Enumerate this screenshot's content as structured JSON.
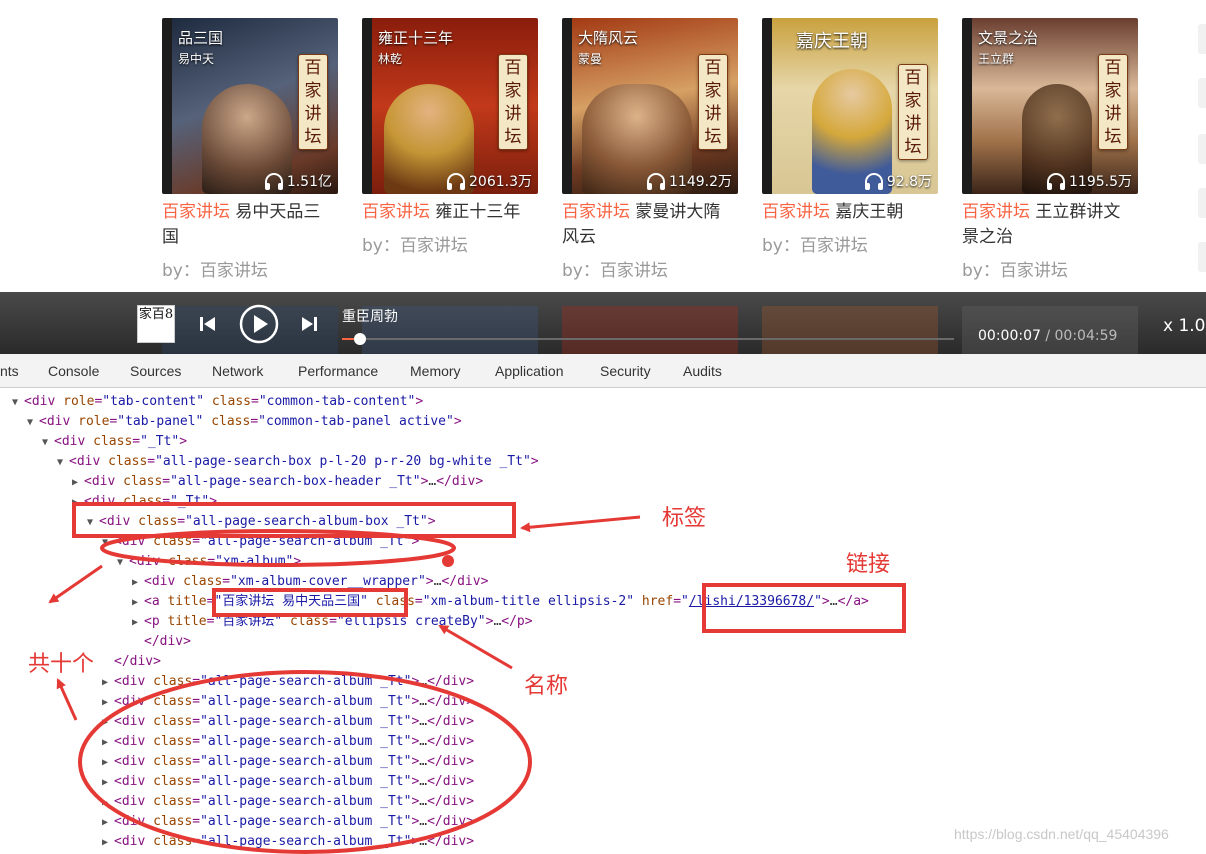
{
  "albums": [
    {
      "cover_title": "品三国",
      "cover_author": "易中天",
      "seal": "百家讲坛",
      "plays": "1.51亿",
      "title_hl": "百家讲坛",
      "title_rest": " 易中天品三国",
      "by": "by：百家讲坛",
      "bg": "#2c3646"
    },
    {
      "cover_title": "雍正十三年",
      "cover_author": "林乾",
      "seal": "百家讲坛",
      "plays": "2061.3万",
      "title_hl": "百家讲坛",
      "title_rest": " 雍正十三年",
      "by": "by：百家讲坛",
      "bg": "#9a2a12"
    },
    {
      "cover_title": "大隋风云",
      "cover_author": "蒙曼",
      "seal": "百家讲坛",
      "plays": "1149.2万",
      "title_hl": "百家讲坛",
      "title_rest": " 蒙曼讲大隋风云",
      "by": "by：百家讲坛",
      "bg": "#8b3b18"
    },
    {
      "cover_title": "嘉庆王朝",
      "cover_author": "",
      "seal": "百家讲坛",
      "plays": "92.8万",
      "title_hl": "百家讲坛",
      "title_rest": " 嘉庆王朝",
      "by": "by：百家讲坛",
      "bg": "#b89a3a"
    },
    {
      "cover_title": "文景之治",
      "cover_author": "王立群",
      "seal": "百家讲坛",
      "plays": "1195.5万",
      "title_hl": "百家讲坛",
      "title_rest": " 王立群讲文景之治",
      "by": "by：百家讲坛",
      "bg": "#5a4a3c"
    }
  ],
  "player": {
    "thumb": "家百8",
    "track_title": "重臣周勃",
    "current": "00:00:07",
    "separator": " / ",
    "duration": "00:04:59",
    "speed": "x 1.0",
    "progress": 0.03
  },
  "devtools": {
    "tabs": [
      "nts",
      "Console",
      "Sources",
      "Network",
      "Performance",
      "Memory",
      "Application",
      "Security",
      "Audits"
    ]
  },
  "annotations": {
    "tag": "标签",
    "link": "链接",
    "name": "名称",
    "count": "共十个"
  },
  "watermark": "https://blog.csdn.net/qq_45404396",
  "colors": {
    "accent": "#f86442",
    "annotation": "#e53935"
  }
}
